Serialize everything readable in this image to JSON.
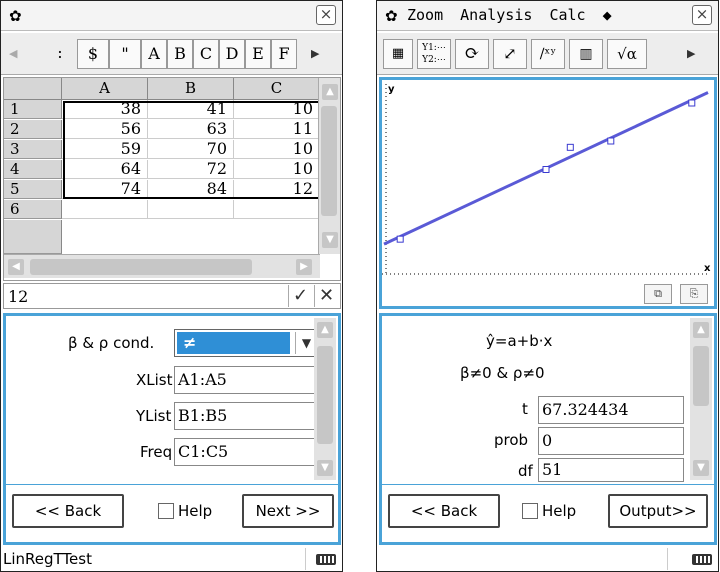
{
  "left": {
    "title_icon": "gear-icon",
    "close_label": "×",
    "toolbar": {
      "buttons": [
        ":",
        "$",
        "\"",
        "A",
        "B",
        "C",
        "D",
        "E",
        "F"
      ]
    },
    "sheet": {
      "columns": [
        "A",
        "B",
        "C"
      ],
      "rows": [
        {
          "n": "1",
          "a": "38",
          "b": "41",
          "c": "10"
        },
        {
          "n": "2",
          "a": "56",
          "b": "63",
          "c": "11"
        },
        {
          "n": "3",
          "a": "59",
          "b": "70",
          "c": "10"
        },
        {
          "n": "4",
          "a": "64",
          "b": "72",
          "c": "10"
        },
        {
          "n": "5",
          "a": "74",
          "b": "84",
          "c": "12"
        },
        {
          "n": "6",
          "a": "",
          "b": "",
          "c": ""
        }
      ]
    },
    "edit_value": "12",
    "wizard": {
      "cond_label": "β & ρ cond.",
      "cond_value": "≠",
      "xlist_label": "XList",
      "xlist_value": "A1:A5",
      "ylist_label": "YList",
      "ylist_value": "B1:B5",
      "freq_label": "Freq",
      "freq_value": "C1:C5",
      "back": "<< Back",
      "help": "Help",
      "next": "Next >>"
    },
    "status": "LinRegTTest"
  },
  "right": {
    "menus": [
      "Zoom",
      "Analysis",
      "Calc",
      "◆"
    ],
    "close_label": "×",
    "axis_y": "y",
    "axis_x": "x",
    "points": [
      {
        "x": 38,
        "y": 41
      },
      {
        "x": 56,
        "y": 63
      },
      {
        "x": 59,
        "y": 70
      },
      {
        "x": 64,
        "y": 72
      },
      {
        "x": 74,
        "y": 84
      }
    ],
    "wizard": {
      "model": "ŷ=a+b·x",
      "hypothesis": "β≠0 & ρ≠0",
      "t_label": "t",
      "t_value": "67.324434",
      "prob_label": "prob",
      "prob_value": "0",
      "df_label": "df",
      "df_value": "51",
      "back": "<< Back",
      "help": "Help",
      "output": "Output>>"
    }
  }
}
